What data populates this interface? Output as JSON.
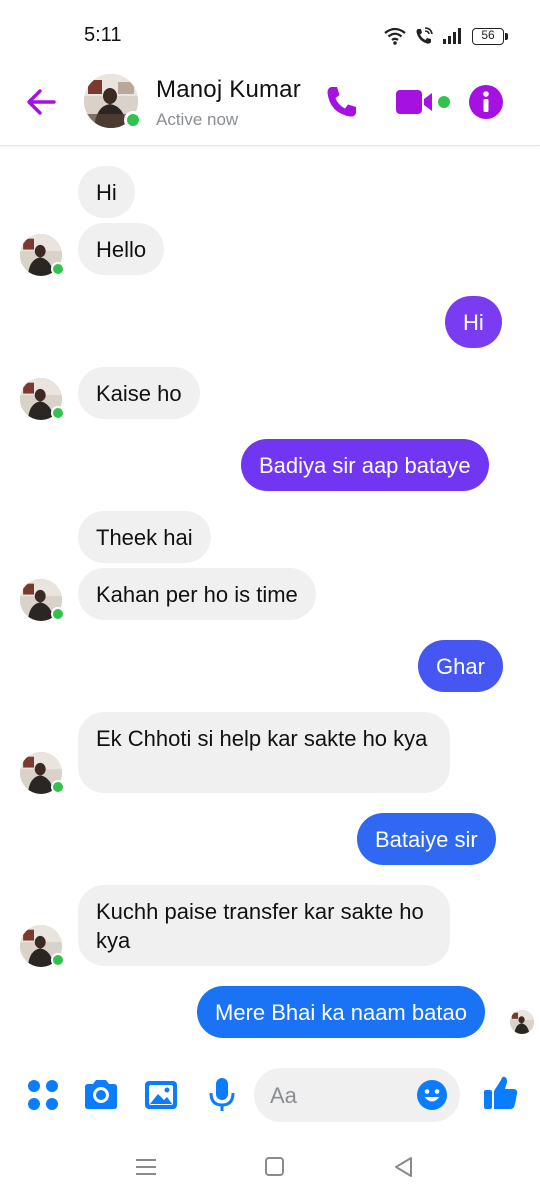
{
  "status_bar": {
    "time": "5:11",
    "battery": "56"
  },
  "header": {
    "contact_name": "Manoj Kumar",
    "contact_status": "Active now",
    "icons": [
      "back-arrow-icon",
      "phone-icon",
      "video-camera-icon",
      "info-icon"
    ],
    "accent_color": "#a511e0"
  },
  "messages": [
    {
      "from": "them",
      "text": "Hi"
    },
    {
      "from": "them",
      "text": "Hello"
    },
    {
      "from": "me",
      "text": "Hi"
    },
    {
      "from": "them",
      "text": "Kaise ho"
    },
    {
      "from": "me",
      "text": "Badiya sir aap bataye"
    },
    {
      "from": "them",
      "text": "Theek hai"
    },
    {
      "from": "them",
      "text": "Kahan per ho is time"
    },
    {
      "from": "me",
      "text": "Ghar"
    },
    {
      "from": "them",
      "text": "Ek Chhoti si help kar sakte ho kya"
    },
    {
      "from": "me",
      "text": "Bataiye sir"
    },
    {
      "from": "them",
      "text": "Kuchh paise transfer kar sakte ho kya"
    },
    {
      "from": "me",
      "text": "Mere Bhai ka naam batao"
    }
  ],
  "composer": {
    "placeholder": "Aa",
    "icons": [
      "menu-dots-icon",
      "camera-icon",
      "gallery-icon",
      "microphone-icon",
      "emoji-icon",
      "thumbs-up-icon"
    ],
    "icon_color": "#0a7cff"
  },
  "colors": {
    "out_bubble_purple": "#7a3cf2",
    "out_bubble_indigo": "#4656f2",
    "out_bubble_blue": "#1a73f5",
    "in_bubble": "#f0f0f0",
    "online": "#31c24d"
  }
}
